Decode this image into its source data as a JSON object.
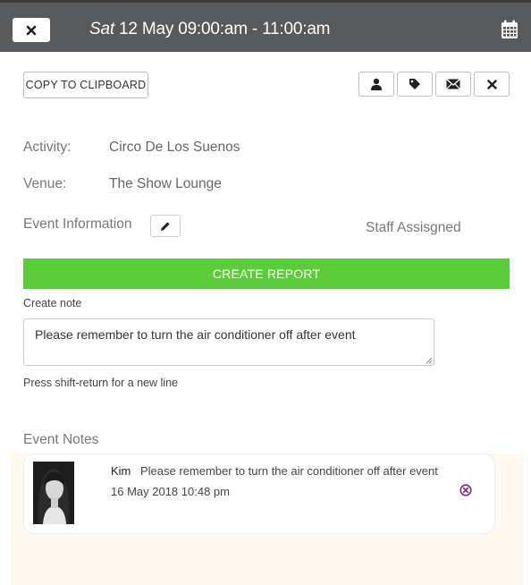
{
  "header": {
    "close_icon": "close-icon",
    "day": "Sat",
    "datetime": "12 May 09:00:am - 11:00:am",
    "calendar_icon": "calendar-icon"
  },
  "toolbar": {
    "copy_label": "COPY TO CLIPBOARD",
    "icons": [
      "user-icon",
      "tag-icon",
      "envelope-icon",
      "close-icon"
    ]
  },
  "details": {
    "activity_label": "Activity:",
    "activity_value": "Circo De Los Suenos",
    "venue_label": "Venue:",
    "venue_value": "The Show Lounge",
    "event_info_label": "Event Information",
    "staff_label": "Staff Assisgned"
  },
  "report": {
    "button_label": "CREATE REPORT",
    "button_color": "#5ccd3a"
  },
  "note_form": {
    "label": "Create note",
    "value": "Please remember to turn the air conditioner off after event",
    "hint": "Press shift-return for a new line"
  },
  "notes": {
    "title": "Event Notes",
    "items": [
      {
        "author": "Kim",
        "text": "Please remember to turn the air conditioner off after event",
        "date": "16 May 2018 10:48 pm",
        "delete_icon": "circle-x-icon",
        "delete_color": "#7b2a7e"
      }
    ]
  }
}
